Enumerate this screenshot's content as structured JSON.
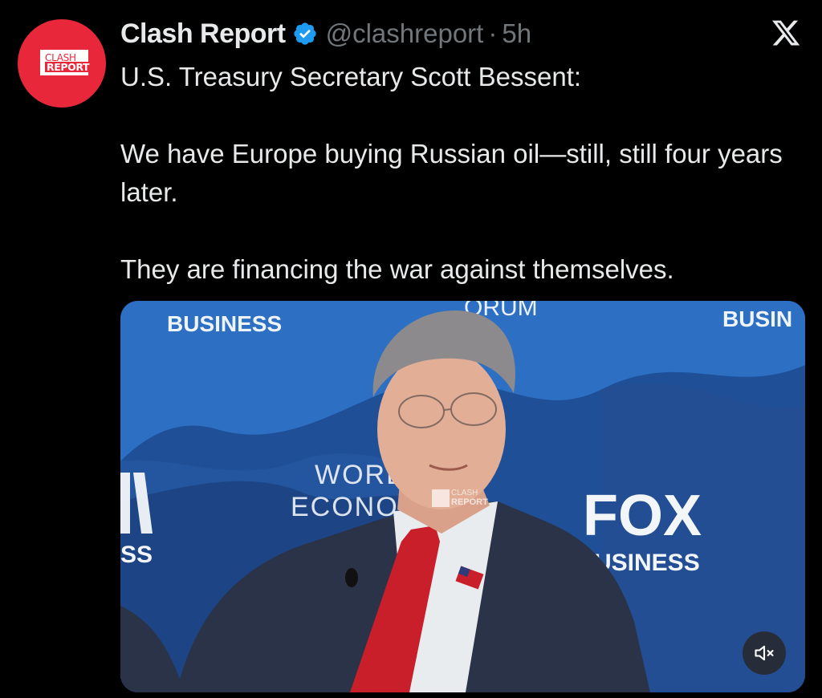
{
  "account": {
    "display_name": "Clash Report",
    "handle": "@clashreport",
    "separator": "·",
    "time": "5h",
    "avatar_text_line1": "CLASH",
    "avatar_text_line2": "REPORT"
  },
  "tweet": {
    "line1": "U.S. Treasury Secretary Scott Bessent:",
    "line2": "We have Europe buying Russian oil—still, still four years later.",
    "line3": "They are financing the war against themselves."
  },
  "media": {
    "backdrop_texts": {
      "business_top_left": "BUSINESS",
      "forum": "ORUM",
      "business_top_right": "BUSIN",
      "world": "WORL",
      "economic": "ECONO",
      "fox": "FOX",
      "business_right": "USINESS",
      "ss_left": "SS",
      "watermark_l1": "CLASH",
      "watermark_l2": "REPORT"
    }
  },
  "icons": {
    "verified": "verified-badge-icon",
    "close": "x-logo-icon",
    "mute": "speaker-muted-icon"
  },
  "colors": {
    "background": "#000000",
    "text_primary": "#e7e9ea",
    "text_secondary": "#71767b",
    "verified_blue": "#1d9bf0",
    "brand_red": "#e8283a"
  }
}
